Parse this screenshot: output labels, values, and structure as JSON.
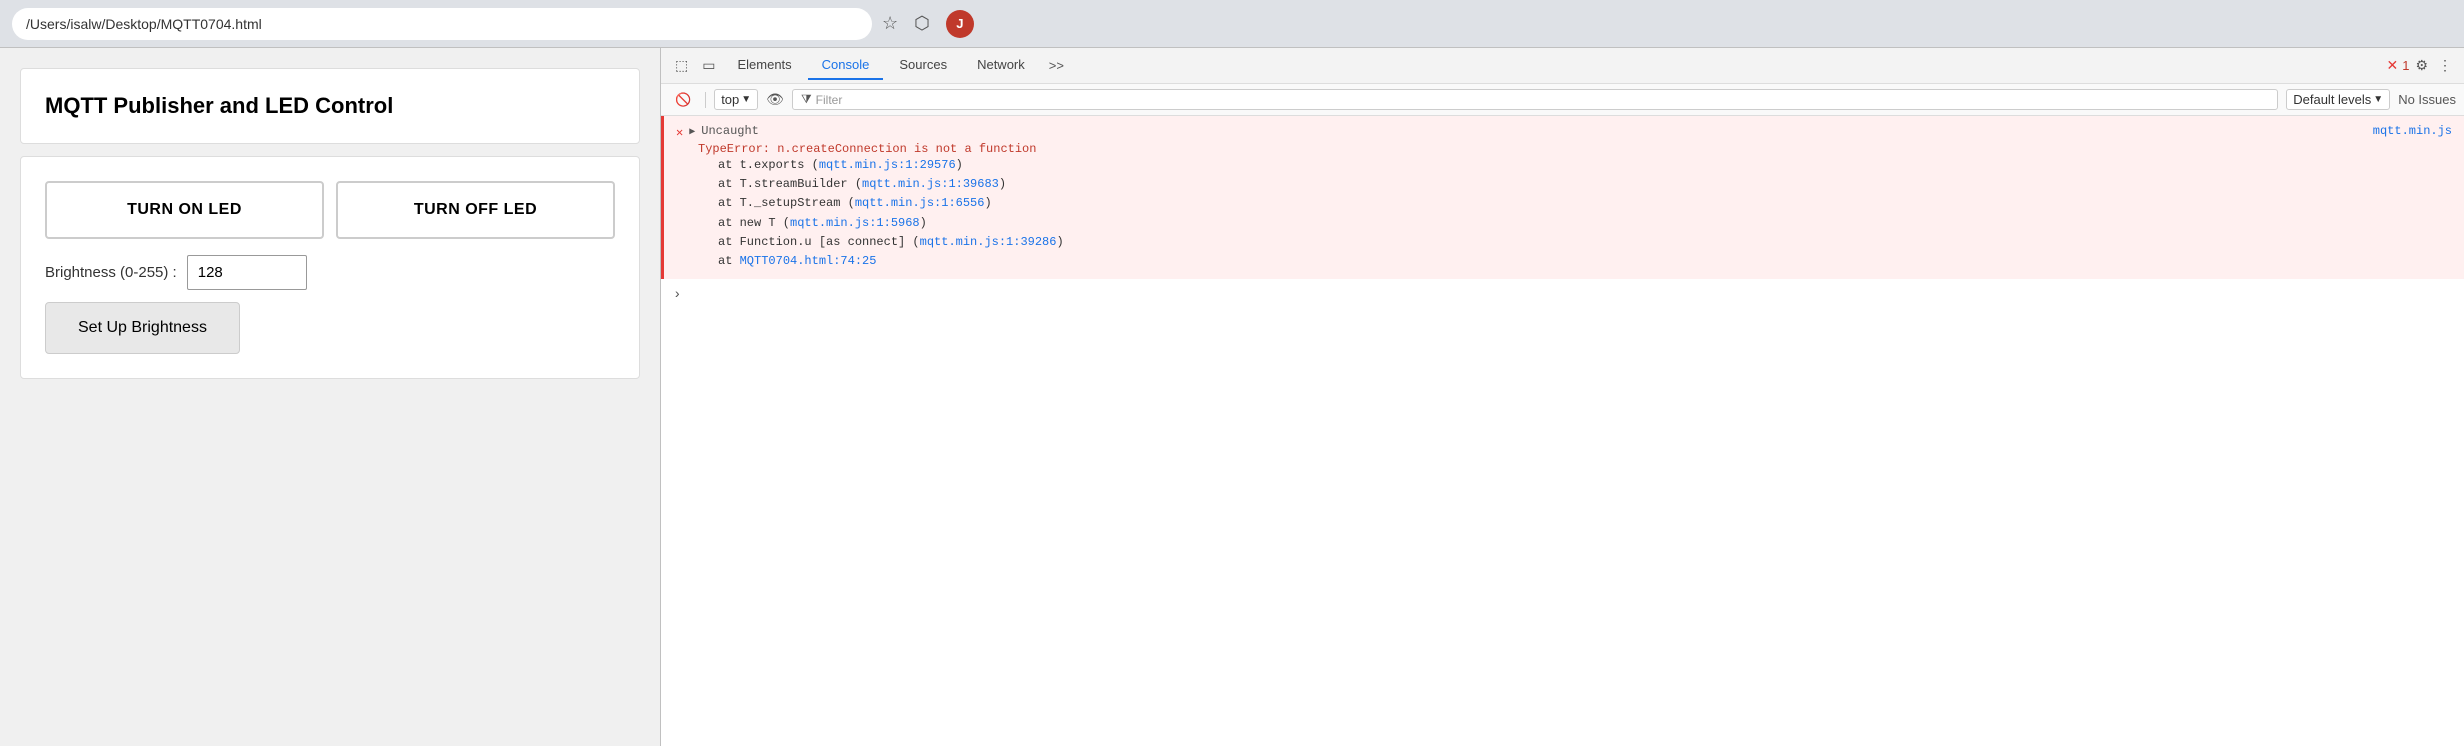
{
  "browser": {
    "address": "/Users/isalw/Desktop/MQTT0704.html",
    "star_icon": "★",
    "extensions_icon": "⬡",
    "avatar_label": "J"
  },
  "devtools": {
    "tabs": [
      "Elements",
      "Console",
      "Sources",
      "Network",
      ">>"
    ],
    "active_tab": "Console",
    "error_count": "1",
    "top_label": "top",
    "filter_placeholder": "Filter",
    "default_levels_label": "Default levels",
    "no_issues_label": "No Issues"
  },
  "console": {
    "uncaught_label": "Uncaught",
    "error_message": "TypeError: n.createConnection is not a function",
    "stack": [
      {
        "text": "at t.exports (",
        "link": "mqtt.min.js:1:29576",
        "after": ")"
      },
      {
        "text": "at T.streamBuilder (",
        "link": "mqtt.min.js:1:39683",
        "after": ")"
      },
      {
        "text": "at T._setupStream (",
        "link": "mqtt.min.js:1:6556",
        "after": ")"
      },
      {
        "text": "at new T (",
        "link": "mqtt.min.js:1:5968",
        "after": ")"
      },
      {
        "text": "at Function.u [as connect] (",
        "link": "mqtt.min.js:1:39286",
        "after": ")"
      },
      {
        "text": "at ",
        "link": "MQTT0704.html:74:25",
        "after": ""
      }
    ],
    "source_link": "mqtt.min.js"
  },
  "page": {
    "title": "MQTT Publisher and LED Control",
    "turn_on_label": "TURN ON LED",
    "turn_off_label": "TURN OFF LED",
    "brightness_label": "Brightness  (0-255)  :",
    "brightness_value": "128",
    "setup_btn_label": "Set Up Brightness"
  }
}
